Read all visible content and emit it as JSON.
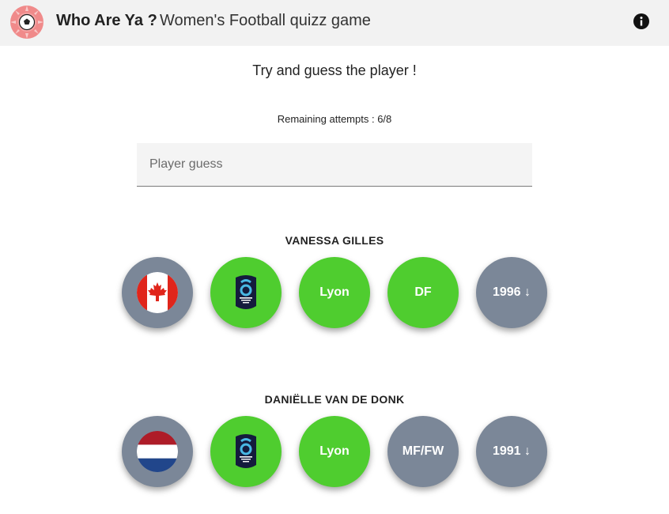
{
  "header": {
    "title": "Who Are Ya ?",
    "subtitle": "Women's Football quizz game"
  },
  "prompt": "Try and guess the player !",
  "attempts": {
    "label": "Remaining attempts : ",
    "value": "6/8"
  },
  "guess_input": {
    "placeholder": "Player guess",
    "value": ""
  },
  "guesses": [
    {
      "name": "VANESSA GILLES",
      "nationality": {
        "icon": "canada-flag-icon",
        "status": "incorrect"
      },
      "league": {
        "icon": "arkema-premiere-ligue-icon",
        "status": "correct"
      },
      "club": {
        "label": "Lyon",
        "status": "correct"
      },
      "position": {
        "label": "DF",
        "status": "correct"
      },
      "birth_year": {
        "label": "1996 ↓",
        "status": "incorrect"
      }
    },
    {
      "name": "DANIËLLE VAN DE DONK",
      "nationality": {
        "icon": "netherlands-flag-icon",
        "status": "incorrect"
      },
      "league": {
        "icon": "arkema-premiere-ligue-icon",
        "status": "correct"
      },
      "club": {
        "label": "Lyon",
        "status": "correct"
      },
      "position": {
        "label": "MF/FW",
        "status": "incorrect"
      },
      "birth_year": {
        "label": "1991 ↓",
        "status": "incorrect"
      }
    }
  ],
  "colors": {
    "correct": "#4fcd2f",
    "incorrect": "#7b8798",
    "header_bg": "#f2f2f2",
    "logo": "#f07b7b"
  }
}
